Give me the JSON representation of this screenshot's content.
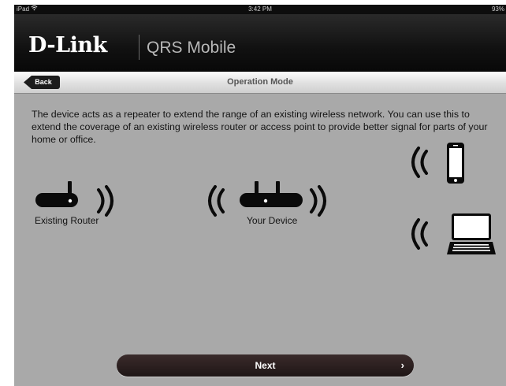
{
  "status_bar": {
    "carrier": "iPad",
    "wifi_icon": "wifi-icon",
    "time": "3:42 PM",
    "battery": "93%"
  },
  "header": {
    "logo": "D-Link",
    "app_name": "QRS Mobile"
  },
  "navbar": {
    "back_label": "Back",
    "title": "Operation Mode"
  },
  "description": "The device acts as a repeater to extend the range of an existing wireless network. You can use this to extend the coverage of an existing wireless router or access point to provide better signal for parts of your home or office.",
  "diagram": {
    "existing_router_label": "Existing Router",
    "your_device_label": "Your Device",
    "icons": [
      "router-icon",
      "repeater-icon",
      "phone-icon",
      "laptop-icon",
      "wifi-wave-icon"
    ]
  },
  "footer": {
    "next_label": "Next",
    "next_chevron": "›"
  },
  "colors": {
    "background": "#a9a9a9",
    "header": "#111111",
    "button": "#2b1f1f"
  }
}
